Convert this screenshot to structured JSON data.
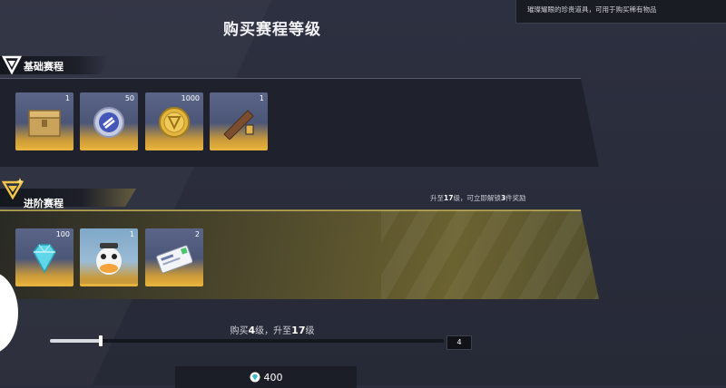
{
  "header": {
    "title": "购买赛程等级",
    "tooltip": "璀璨耀眼的珍贵道具，可用于购买稀有物品"
  },
  "basic_track": {
    "label": "基础赛程",
    "items": [
      {
        "icon": "treasure-chest-icon",
        "qty": "1"
      },
      {
        "icon": "blue-coin-icon",
        "qty": "50"
      },
      {
        "icon": "gold-coin-icon",
        "qty": "1000"
      },
      {
        "icon": "wooden-plank-icon",
        "qty": "1"
      }
    ]
  },
  "advanced_track": {
    "label": "进阶赛程",
    "hint_prefix": "升至",
    "hint_level": "17",
    "hint_mid": "级，可立即解锁",
    "hint_count": "3",
    "hint_suffix": "件奖励",
    "items": [
      {
        "icon": "diamond-icon",
        "qty": "100"
      },
      {
        "icon": "duck-avatar-icon",
        "qty": "1"
      },
      {
        "icon": "ticket-card-icon",
        "qty": "2"
      }
    ]
  },
  "purchase": {
    "text_prefix": "购买",
    "levels": "4",
    "text_mid": "级，升至",
    "target_level": "17",
    "text_suffix": "级",
    "quantity": "4",
    "slider_fraction": 0.13,
    "price": "400",
    "currency_icon": "diamond-currency-icon"
  },
  "colors": {
    "background": "#2a2d3b",
    "basic_panel": "#1f212c",
    "advanced_panel": "#6b6230",
    "card_accent": "#e6b23e"
  }
}
